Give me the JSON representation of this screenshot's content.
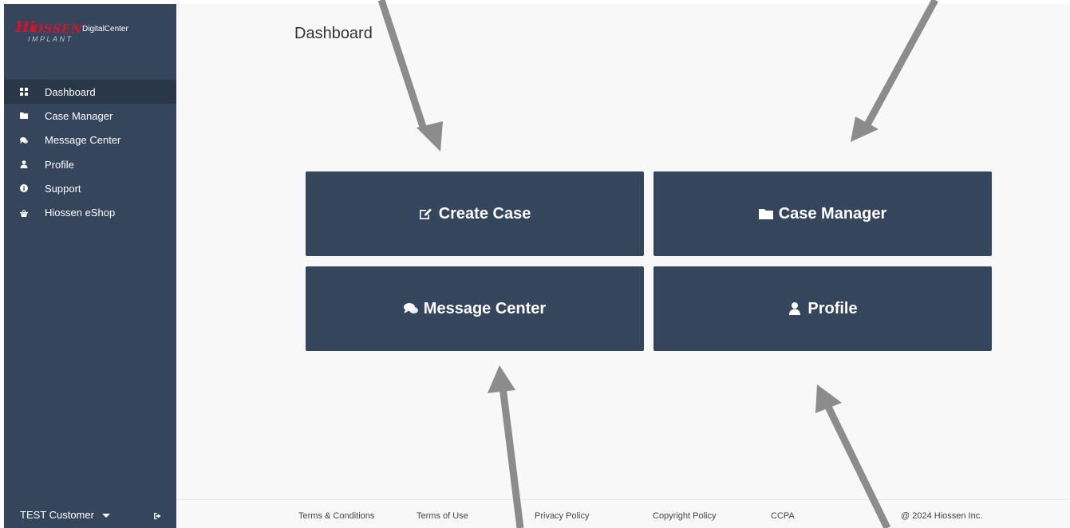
{
  "brand": {
    "logo_hi": "Hi",
    "logo_ossen": "OSSEN",
    "logo_implant": "IMPLANT",
    "product": "DigitalCenter",
    "logo_color": "#d6132a"
  },
  "sidebar": {
    "items": [
      {
        "label": "Dashboard",
        "icon": "dashboard-grid-icon",
        "active": true
      },
      {
        "label": "Case Manager",
        "icon": "folder-icon",
        "active": false
      },
      {
        "label": "Message Center",
        "icon": "chat-bubbles-icon",
        "active": false
      },
      {
        "label": "Profile",
        "icon": "user-icon",
        "active": false
      },
      {
        "label": "Support",
        "icon": "info-circle-icon",
        "active": false
      },
      {
        "label": "Hiossen eShop",
        "icon": "shopping-basket-icon",
        "active": false
      }
    ],
    "user_name": "TEST Customer",
    "user_menu_icon": "caret-down-icon",
    "logout_icon": "sign-out-icon"
  },
  "main": {
    "title": "Dashboard",
    "tiles": [
      {
        "label": "Create Case",
        "icon": "edit-icon"
      },
      {
        "label": "Case Manager",
        "icon": "folder-icon"
      },
      {
        "label": "Message Center",
        "icon": "chat-bubbles-icon"
      },
      {
        "label": "Profile",
        "icon": "user-icon"
      }
    ]
  },
  "footer": {
    "links": [
      "Terms & Conditions",
      "Terms of Use",
      "Privacy Policy",
      "Copyright Policy",
      "CCPA"
    ],
    "copyright": "@ 2024 Hiossen Inc."
  },
  "colors": {
    "sidebar_bg": "#34455c",
    "sidebar_active_bg": "#2a3748",
    "tile_bg": "#34455c",
    "content_bg": "#f8f8f8",
    "annotation_arrow": "#8c8c8c"
  }
}
